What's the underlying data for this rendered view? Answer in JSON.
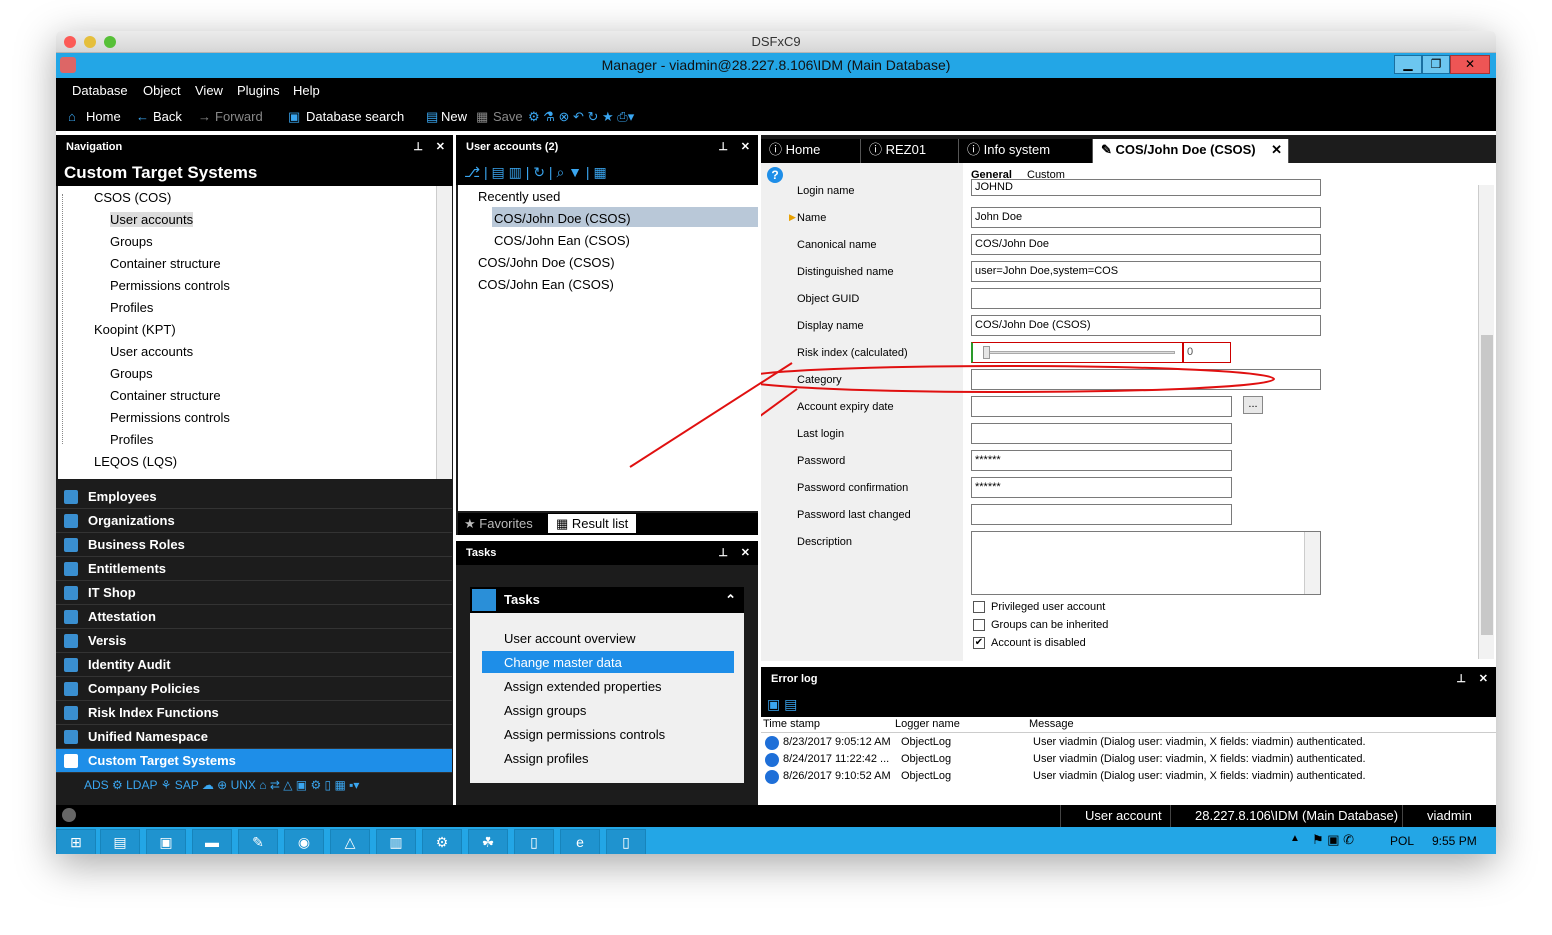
{
  "mac_title": "DSFxC9",
  "window_title": "Manager - viadmin@28.227.8.106\\IDM (Main Database)",
  "menu": [
    "Database",
    "Object",
    "View",
    "Plugins",
    "Help"
  ],
  "toolbar": {
    "home": "Home",
    "back": "Back",
    "forward": "Forward",
    "db_search": "Database search",
    "new": "New",
    "save": "Save"
  },
  "navigation": {
    "header": "Navigation",
    "title": "Custom Target Systems",
    "tree": [
      {
        "label": "CSOS (COS)"
      },
      {
        "label": "User accounts"
      },
      {
        "label": "Groups"
      },
      {
        "label": "Container structure"
      },
      {
        "label": "Permissions controls"
      },
      {
        "label": "Profiles"
      },
      {
        "label": "Koopint (KPT)"
      },
      {
        "label": "User accounts"
      },
      {
        "label": "Groups"
      },
      {
        "label": "Container structure"
      },
      {
        "label": "Permissions controls"
      },
      {
        "label": "Profiles"
      },
      {
        "label": "LEQOS (LQS)"
      }
    ],
    "items": [
      "Employees",
      "Organizations",
      "Business Roles",
      "Entitlements",
      "IT Shop",
      "Attestation",
      "Versis",
      "Identity Audit",
      "Company Policies",
      "Risk Index Functions",
      "Unified Namespace",
      "Custom Target Systems"
    ],
    "bottom_icons": [
      "ADS",
      "LDAP",
      "SAP",
      "UNX"
    ]
  },
  "user_accounts": {
    "header": "User accounts (2)",
    "recent": "Recently used",
    "rows": [
      "COS/John Doe (CSOS)",
      "COS/John Ean (CSOS)",
      "COS/John Doe (CSOS)",
      "COS/John Ean (CSOS)"
    ],
    "tab_favorites": "Favorites",
    "tab_results": "Result list"
  },
  "tasks": {
    "header": "Tasks",
    "box_title": "Tasks",
    "items": [
      "User account overview",
      "Change master data",
      "Assign extended properties",
      "Assign groups",
      "Assign permissions controls",
      "Assign profiles"
    ]
  },
  "doc_tabs": [
    "Home",
    "REZ01",
    "Info system",
    "COS/John Doe (CSOS)"
  ],
  "form": {
    "tab_general": "General",
    "tab_custom": "Custom",
    "labels": [
      "Login name",
      "Name",
      "Canonical name",
      "Distinguished name",
      "Object GUID",
      "Display name",
      "Risk index (calculated)",
      "Category",
      "Account expiry date",
      "Last login",
      "Password",
      "Password confirmation",
      "Password last changed",
      "Description"
    ],
    "values": {
      "login": "JOHND",
      "name": "John Doe",
      "canonical": "COS/John Doe",
      "distinguished": "user=John Doe,system=COS",
      "guid": "",
      "display": "COS/John Doe (CSOS)",
      "risk": "0",
      "password": "******",
      "password_confirm": "******"
    },
    "checkboxes": [
      {
        "label": "Privileged user account",
        "checked": false
      },
      {
        "label": "Groups can be inherited",
        "checked": false
      },
      {
        "label": "Account is disabled",
        "checked": true
      }
    ],
    "ellipsis": "..."
  },
  "errorlog": {
    "header": "Error log",
    "columns": [
      "Time stamp",
      "Logger name",
      "Message"
    ],
    "rows": [
      {
        "time": "8/23/2017 9:05:12 AM",
        "logger": "ObjectLog",
        "msg": "User viadmin (Dialog user: viadmin, X fields: viadmin) authenticated."
      },
      {
        "time": "8/24/2017 11:22:42 ...",
        "logger": "ObjectLog",
        "msg": "User viadmin (Dialog user: viadmin, X fields: viadmin) authenticated."
      },
      {
        "time": "8/26/2017 9:10:52 AM",
        "logger": "ObjectLog",
        "msg": "User viadmin (Dialog user: viadmin, X fields: viadmin) authenticated."
      }
    ]
  },
  "status": {
    "object": "User account",
    "db": "28.227.8.106\\IDM (Main Database)",
    "user": "viadmin"
  },
  "taskbar": {
    "lang": "POL",
    "time": "9:55 PM"
  },
  "colors": {
    "accent": "#23a6e6",
    "selection": "#1e8ee8",
    "annotation": "#e01010"
  }
}
